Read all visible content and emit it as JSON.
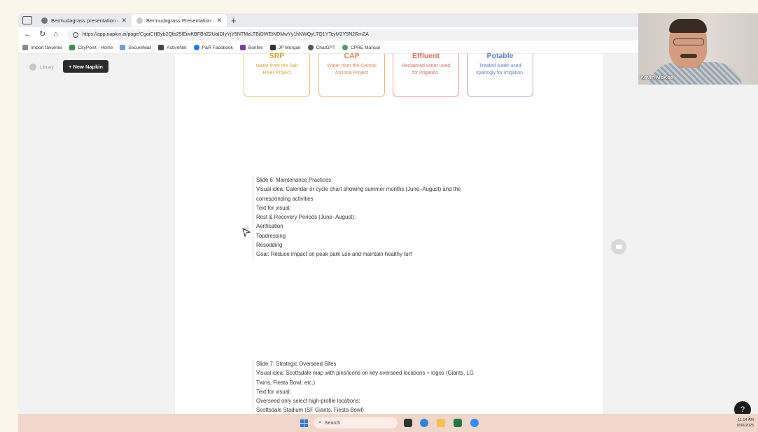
{
  "browser": {
    "tabs": [
      {
        "title": "Bermudagrass presentation outli",
        "active": false
      },
      {
        "title": "Bermudagrass Presentation - Na",
        "active": true
      }
    ],
    "url": "https://app.napkin.ai/page/CgoiCHByb2Qtb25lEiwKBFBhZ2UaIDIyYjY5NTMzLTBiOWEtNDMwYy1hNWQyLTQ1YTcyM2Y5N2RmZA",
    "favorites": [
      "Import favorites",
      "CityPoint - Home",
      "SecureMail",
      "ActiveNet",
      "P&R Facebook",
      "Bonfire",
      "JP Morgan",
      "ChatGPT",
      "CPRE Manual"
    ]
  },
  "sidebar": {
    "library_label": "Library",
    "new_napkin_label": "+ New Napkin"
  },
  "water_cards": [
    {
      "title": "SRP",
      "desc": "Water from the Salt River Project"
    },
    {
      "title": "CAP",
      "desc": "Water from the Central Arizona Project"
    },
    {
      "title": "Effluent",
      "desc": "Reclaimed water used for irrigation."
    },
    {
      "title": "Potable",
      "desc": "Treated water used sparingly for irrigation."
    }
  ],
  "slide6": {
    "lines": [
      "Slide 6: Maintenance Practices",
      "Visual idea: Calendar or cycle chart showing summer months (June–August) and the",
      "corresponding activities",
      "Text for visual:",
      "Rest & Recovery Periods (June–August):",
      "Aerification",
      "Topdressing",
      "Resodding",
      "Goal: Reduce impact on peak park use and maintain healthy turf"
    ]
  },
  "slide7": {
    "lines": [
      "Slide 7: Strategic Overseed Sites",
      "Visual idea: Scottsdale map with pins/icons on key overseed locations + logos (Giants, LG",
      "Twins, Fiesta Bowl, etc.)",
      "Text for visual:",
      "Overseed only select high-profile locations:",
      "Scottsdale Stadium (SF Giants, Fiesta Bowl)"
    ]
  },
  "taskbar": {
    "search_placeholder": "Search",
    "time": "11:14 AM",
    "date": "9/30/2025"
  },
  "webcam": {
    "participant_name": "Kevin McKee"
  },
  "help_glyph": "?"
}
